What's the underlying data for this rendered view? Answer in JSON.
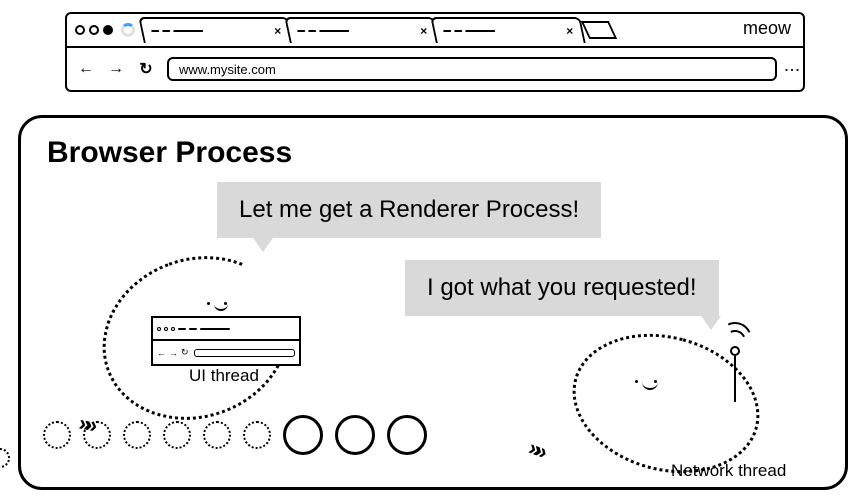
{
  "browser_chrome": {
    "brand": "meow",
    "url": "www.mysite.com"
  },
  "process": {
    "title": "Browser Process",
    "ui_thread": {
      "label": "UI thread",
      "speech": "Let me get a Renderer Process!"
    },
    "network_thread": {
      "label": "Network thread",
      "speech": "I got what you requested!"
    }
  }
}
